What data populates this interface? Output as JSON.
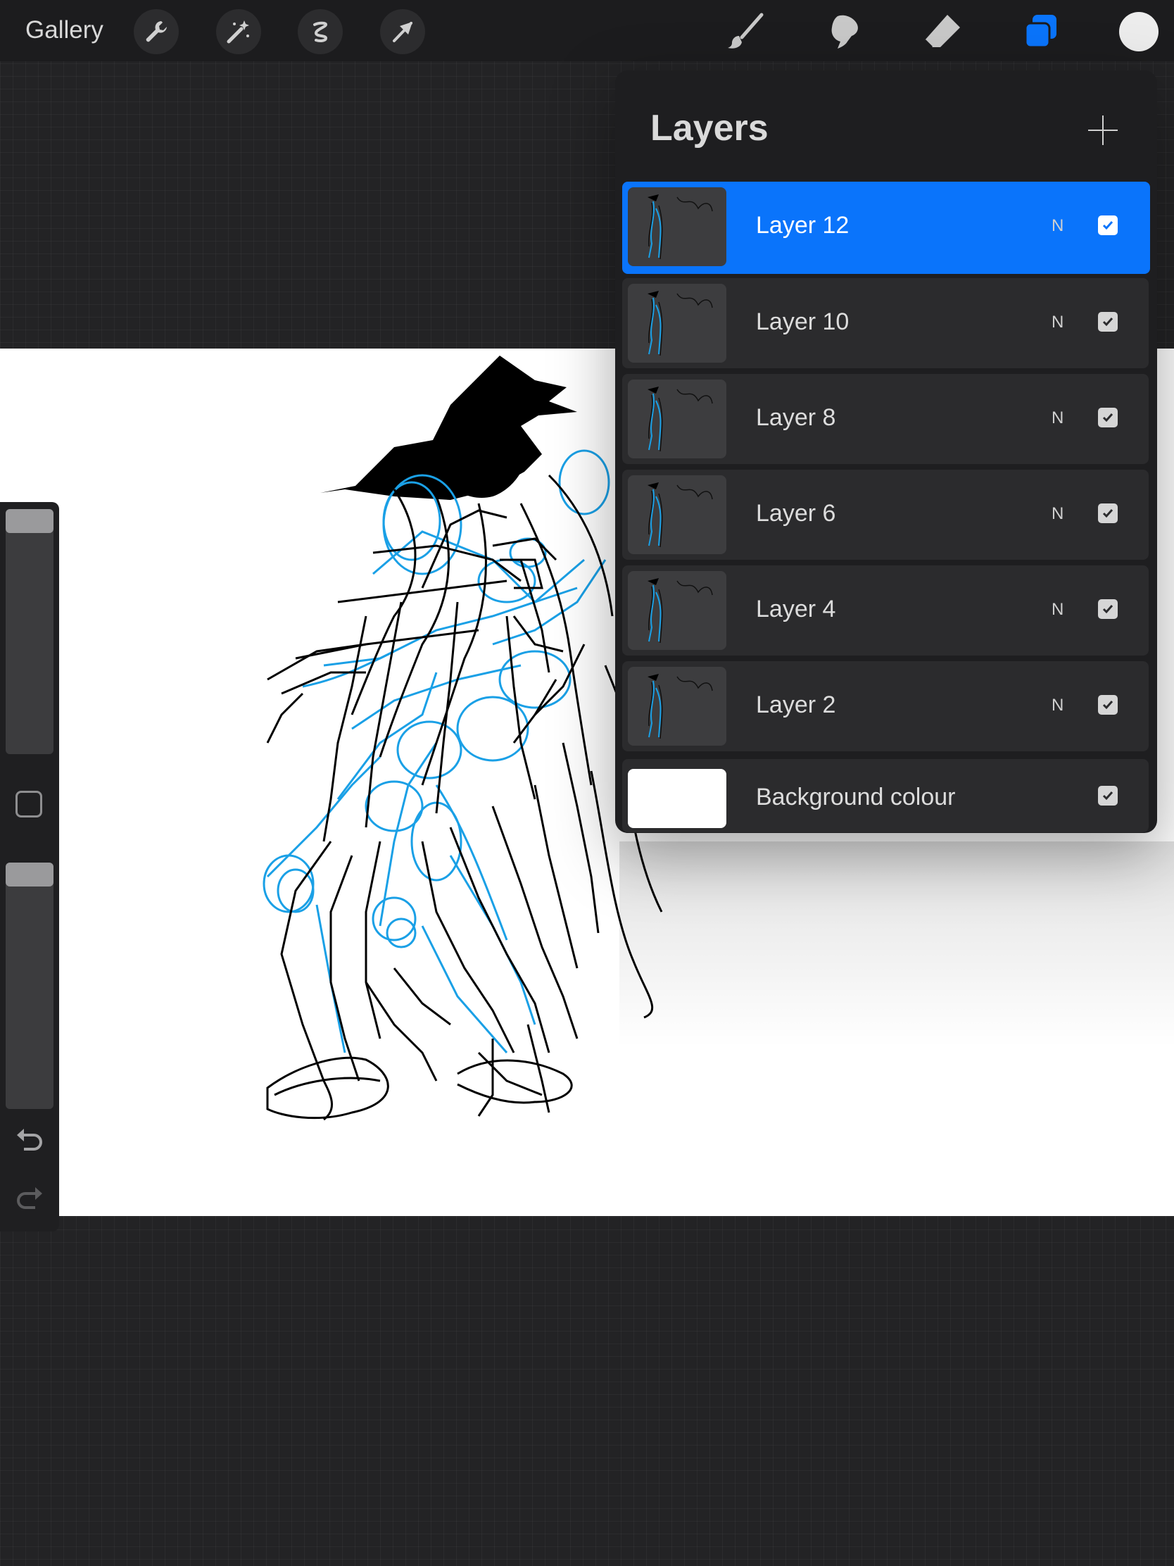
{
  "toolbar": {
    "gallery_label": "Gallery",
    "left_tools": [
      "wrench-icon",
      "magic-wand-icon",
      "selection-icon",
      "transform-arrow-icon"
    ],
    "right_tools": [
      "brush-icon",
      "smudge-icon",
      "eraser-icon",
      "layers-icon"
    ],
    "active_tool": "layers-icon",
    "current_color": "#ececec",
    "accent_color": "#0a74fb"
  },
  "layers_panel": {
    "title": "Layers",
    "add_icon": "plus-icon",
    "layers": [
      {
        "name": "Layer 12",
        "blend": "N",
        "visible": true,
        "selected": true
      },
      {
        "name": "Layer 10",
        "blend": "N",
        "visible": true,
        "selected": false
      },
      {
        "name": "Layer 8",
        "blend": "N",
        "visible": true,
        "selected": false
      },
      {
        "name": "Layer 6",
        "blend": "N",
        "visible": true,
        "selected": false
      },
      {
        "name": "Layer 4",
        "blend": "N",
        "visible": true,
        "selected": false
      },
      {
        "name": "Layer 2",
        "blend": "N",
        "visible": true,
        "selected": false
      }
    ],
    "background": {
      "name": "Background colour",
      "visible": true,
      "color": "#ffffff"
    }
  },
  "sidebar": {
    "brush_size_level": 0.99,
    "opacity_level": 0.99,
    "icons": [
      "modify-square-icon",
      "undo-icon",
      "redo-icon"
    ]
  },
  "sketch": {
    "stroke_colors": [
      "#000000",
      "#1aa0e6"
    ]
  }
}
